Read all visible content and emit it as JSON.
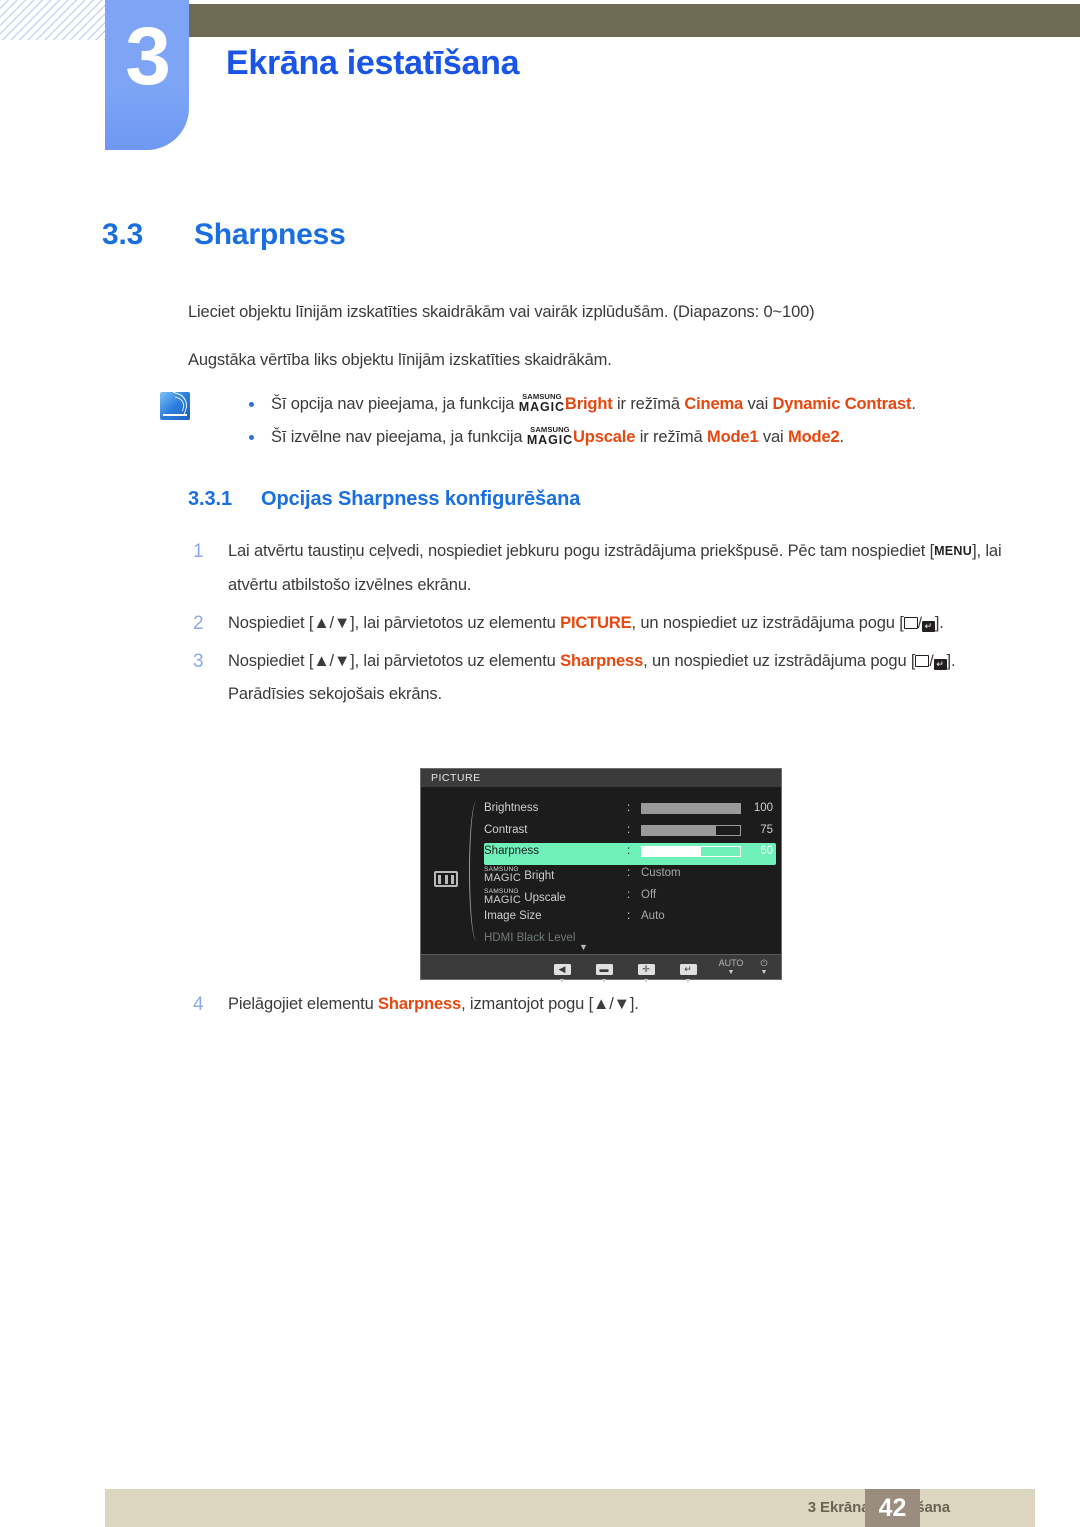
{
  "chapter": {
    "number": "3",
    "title": "Ekrāna iestatīšana"
  },
  "section": {
    "number": "3.3",
    "title": "Sharpness"
  },
  "intro": {
    "line1": "Lieciet objektu līnijām izskatīties skaidrākām vai vairāk izplūdušām. (Diapazons: 0~100)",
    "line2": "Augstāka vērtība liks objektu līnijām izskatīties skaidrākām."
  },
  "note": {
    "icon": "note-pencil-icon",
    "items": [
      {
        "pre": "Šī opcija nav pieejama, ja funkcija ",
        "magic_top": "SAMSUNG",
        "magic_bottom": "MAGIC",
        "feature": "Bright",
        "mid": " ir režīmā ",
        "value1": "Cinema",
        "conj": " vai ",
        "value2": "Dynamic Contrast",
        "end": "."
      },
      {
        "pre": "Šī izvēlne nav pieejama, ja funkcija ",
        "magic_top": "SAMSUNG",
        "magic_bottom": "MAGIC",
        "feature": "Upscale",
        "mid": " ir režīmā ",
        "value1": "Mode1",
        "conj": " vai ",
        "value2": "Mode2",
        "end": "."
      }
    ]
  },
  "subsection": {
    "number": "3.3.1",
    "title": "Opcijas Sharpness konfigurēšana"
  },
  "steps": [
    {
      "num": "1",
      "part1": "Lai atvērtu taustiņu ceļvedi, nospiediet jebkuru pogu izstrādājuma priekšpusē. Pēc tam nospiediet [",
      "key": "MENU",
      "part2": "], lai atvērtu atbilstošo izvēlnes ekrānu."
    },
    {
      "num": "2",
      "part1": "Nospiediet [▲/▼], lai pārvietotos uz elementu ",
      "highlight": "PICTURE",
      "part2": ", un nospiediet uz izstrādājuma pogu [",
      "part3": "]."
    },
    {
      "num": "3",
      "part1": "Nospiediet [▲/▼], lai pārvietotos uz elementu ",
      "highlight": "Sharpness",
      "part2": ", un nospiediet uz izstrādājuma pogu [",
      "part3": "].",
      "followup": "Parādīsies sekojošais ekrāns."
    },
    {
      "num": "4",
      "part1": "Pielāgojiet elementu ",
      "highlight": "Sharpness",
      "part2": ", izmantojot pogu [▲/▼]."
    }
  ],
  "osd": {
    "title": "PICTURE",
    "category_icon": "picture-category-icon",
    "rows": [
      {
        "label": "Brightness",
        "colon": ":",
        "type": "slider",
        "value": "100",
        "fill_pct": 100
      },
      {
        "label": "Contrast",
        "colon": ":",
        "type": "slider",
        "value": "75",
        "fill_pct": 75
      },
      {
        "label": "Sharpness",
        "colon": ":",
        "type": "slider",
        "value": "60",
        "fill_pct": 60,
        "selected": true
      },
      {
        "label_magic_top": "SAMSUNG",
        "label_magic_bottom": "MAGIC",
        "label_suffix": "Bright",
        "colon": ":",
        "type": "text",
        "value": "Custom"
      },
      {
        "label_magic_top": "SAMSUNG",
        "label_magic_bottom": "MAGIC",
        "label_suffix": "Upscale",
        "colon": ":",
        "type": "text",
        "value": "Off"
      },
      {
        "label": "Image Size",
        "colon": ":",
        "type": "text",
        "value": "Auto"
      },
      {
        "label": "HDMI Black Level",
        "type": "dim"
      }
    ],
    "scroll_caret": "▼",
    "buttons": [
      {
        "name": "back-button",
        "symbol": "◀",
        "key": "▼"
      },
      {
        "name": "minus-button",
        "symbol": "▬",
        "key": "▼"
      },
      {
        "name": "plus-button",
        "symbol": "✛",
        "key": "▼"
      },
      {
        "name": "enter-button",
        "symbol": "↵",
        "key": "▼"
      },
      {
        "name": "auto-button",
        "symbol": "AUTO",
        "key": "▼"
      },
      {
        "name": "power-button",
        "symbol": "⏻",
        "key": "▼"
      }
    ]
  },
  "footer": {
    "text": "3 Ekrāna iestatīšana",
    "page": "42"
  },
  "colors": {
    "heading_blue": "#1a6fe0",
    "chapter_blue": "#1a54e8",
    "tab_blue": "#7ea5f5",
    "header_olive": "#6e6b55",
    "orange": "#e8470f",
    "footer_beige": "#dcd5c0",
    "footer_page_brown": "#9a8d7e",
    "osd_highlight_green": "#6ef0b8",
    "osd_label_green": "#3ddba0"
  }
}
